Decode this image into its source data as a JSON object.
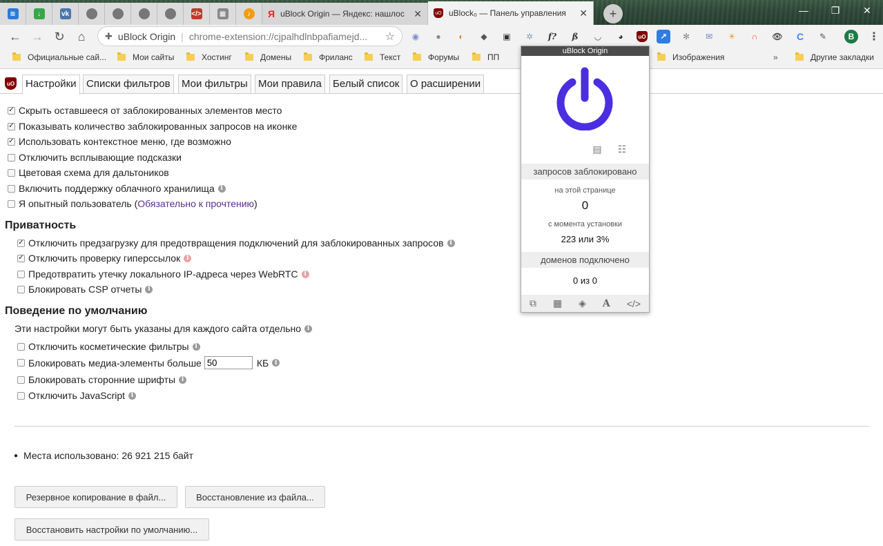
{
  "browser": {
    "tabs": [
      {
        "title": "uBlock Origin — Яндекс: нашлос",
        "favicon": "Я"
      },
      {
        "title": "uBlock₀ — Панель управления",
        "favicon": "uO"
      }
    ],
    "omnibox": {
      "site": "uBlock Origin",
      "url": "chrome-extension://cjpalhdlnbpafiamejd..."
    },
    "bookmarks": [
      "Официальные сай...",
      "Мои сайты",
      "Хостинг",
      "Домены",
      "Фриланс",
      "Текст",
      "Форумы",
      "ПП",
      "Изображения",
      "Другие закладки"
    ],
    "overflow": "»"
  },
  "dashboard": {
    "tabs": [
      "Настройки",
      "Списки фильтров",
      "Мои фильтры",
      "Мои правила",
      "Белый список",
      "О расширении"
    ],
    "general": [
      {
        "label": "Скрыть оставшееся от заблокированных элементов место",
        "checked": true
      },
      {
        "label": "Показывать количество заблокированных запросов на иконке",
        "checked": true
      },
      {
        "label": "Использовать контекстное меню, где возможно",
        "checked": true
      },
      {
        "label": "Отключить всплывающие подсказки",
        "checked": false
      },
      {
        "label": "Цветовая схема для дальтоников",
        "checked": false
      },
      {
        "label": "Включить поддержку облачного хранилища",
        "checked": false
      },
      {
        "label": "Я опытный пользователь (",
        "link": "Обязательно к прочтению",
        "after": ")",
        "checked": false
      }
    ],
    "privacy_title": "Приватность",
    "privacy": [
      {
        "label": "Отключить предзагрузку для предотвращения подключений для заблокированных запросов",
        "checked": true
      },
      {
        "label": "Отключить проверку гиперссылок",
        "checked": true
      },
      {
        "label": "Предотвратить утечку локального IP-адреса через WebRTC",
        "checked": false
      },
      {
        "label": "Блокировать CSP отчеты",
        "checked": false
      }
    ],
    "default_title": "Поведение по умолчанию",
    "default_note": "Эти настройки могут быть указаны для каждого сайта отдельно",
    "default": [
      {
        "label": "Отключить косметические фильтры",
        "checked": false
      },
      {
        "label": "Блокировать медиа-элементы больше",
        "checked": false,
        "value": "50",
        "unit": "КБ"
      },
      {
        "label": "Блокировать сторонние шрифты",
        "checked": false
      },
      {
        "label": "Отключить JavaScript",
        "checked": false
      }
    ],
    "storage": "Места использовано: 26 921 215 байт",
    "buttons": {
      "backup": "Резервное копирование в файл...",
      "restore": "Восстановление из файла...",
      "reset": "Восстановить настройки по умолчанию..."
    }
  },
  "popup": {
    "title": "uBlock Origin",
    "requests_blocked": "запросов заблокировано",
    "on_this_page": "на этой странице",
    "page_count": "0",
    "since_install": "с момента установки",
    "total": "223 или 3%",
    "domains_connected": "доменов подключено",
    "domains": "0 из 0",
    "accent": "#4b2ee0"
  }
}
